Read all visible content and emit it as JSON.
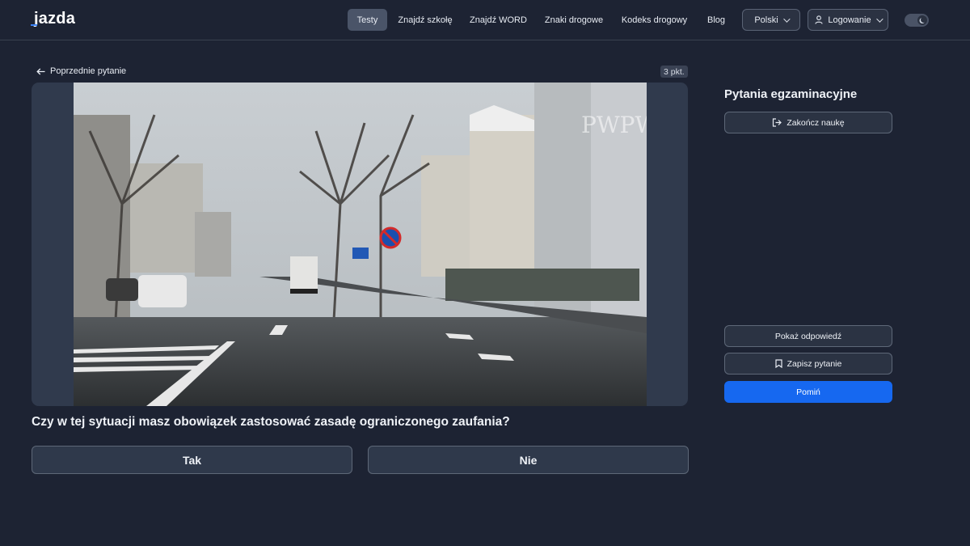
{
  "logo": {
    "text": "jazda",
    "first": "j",
    "rest": "azda"
  },
  "nav": {
    "items": [
      {
        "label": "Testy",
        "active": true
      },
      {
        "label": "Znajdź szkołę"
      },
      {
        "label": "Znajdź WORD"
      },
      {
        "label": "Znaki drogowe"
      },
      {
        "label": "Kodeks drogowy"
      },
      {
        "label": "Blog"
      }
    ],
    "language": "Polski",
    "login": "Logowanie",
    "theme_toggle_icon": "moon-icon"
  },
  "question": {
    "prev_label": "Poprzednie pytanie",
    "points": "3 pkt.",
    "watermark": "PWPW",
    "text": "Czy w tej sytuacji masz obowiązek zastosować zasadę ograniczonego zaufania?",
    "answers": [
      "Tak",
      "Nie"
    ]
  },
  "sidebar": {
    "title": "Pytania egzaminacyjne",
    "finish": "Zakończ naukę",
    "show_answer": "Pokaż odpowiedź",
    "save_question": "Zapisz pytanie",
    "skip": "Pomiń"
  },
  "colors": {
    "background": "#1d2333",
    "accent": "#1668f0",
    "active_tab": "#4a5468"
  }
}
